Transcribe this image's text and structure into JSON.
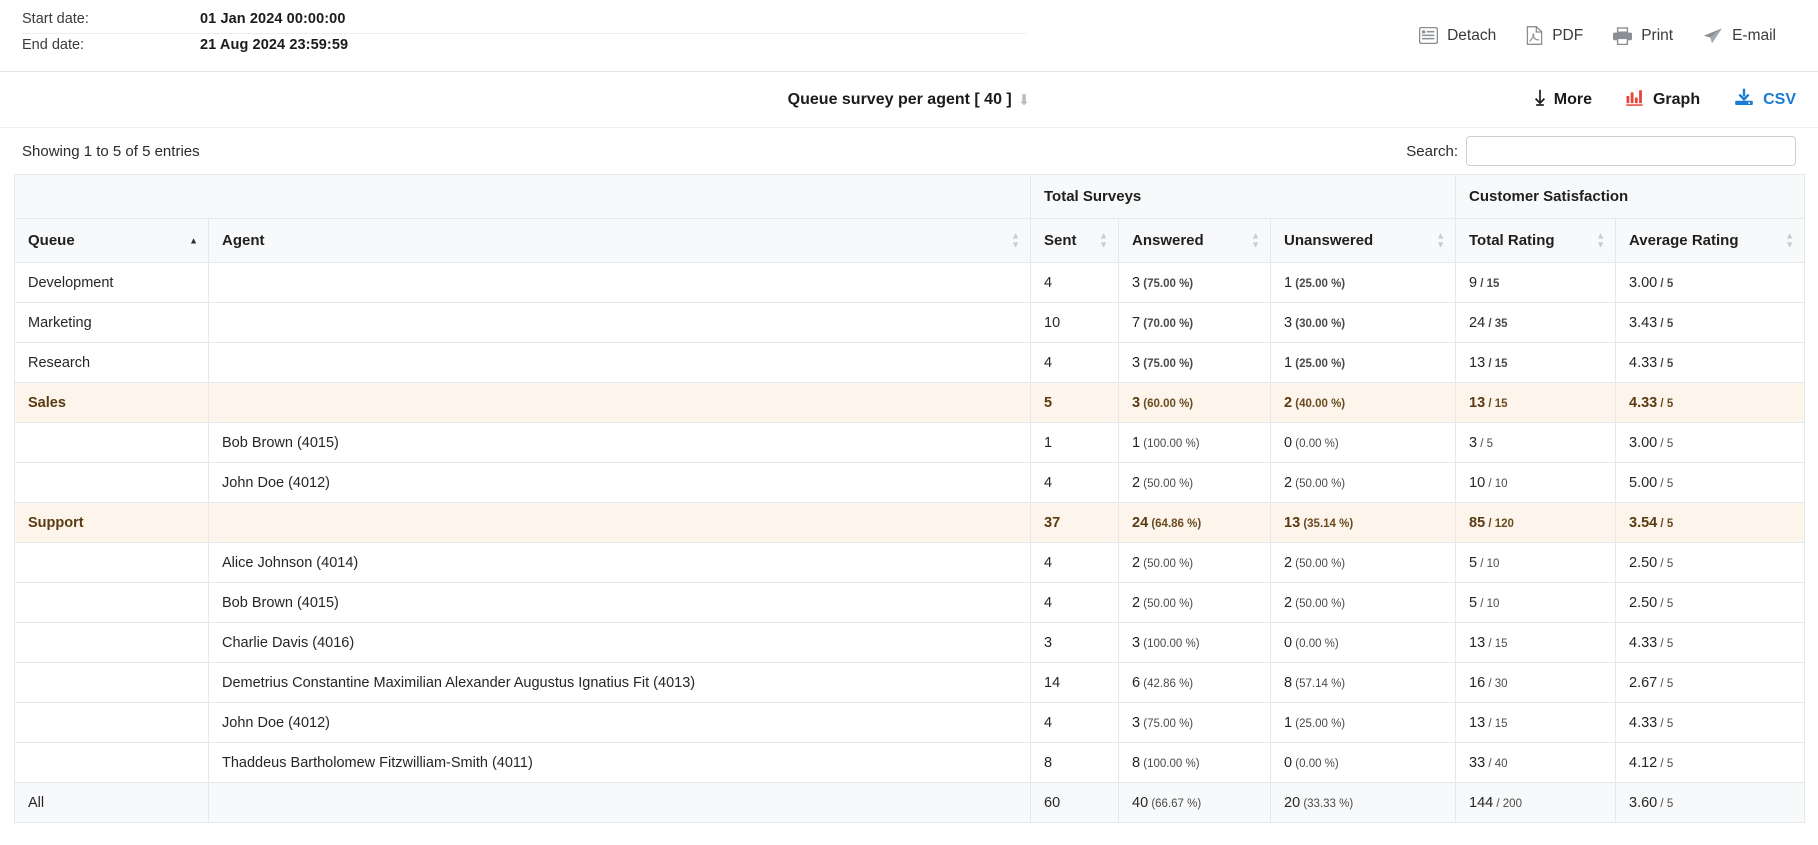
{
  "header": {
    "start_label": "Start date:",
    "start_value": "01 Jan 2024 00:00:00",
    "end_label": "End date:",
    "end_value": "21 Aug 2024 23:59:59",
    "actions": [
      {
        "name": "detach",
        "label": "Detach",
        "icon": "detach-icon"
      },
      {
        "name": "pdf",
        "label": "PDF",
        "icon": "pdf-icon"
      },
      {
        "name": "print",
        "label": "Print",
        "icon": "printer-icon"
      },
      {
        "name": "email",
        "label": "E-mail",
        "icon": "send-icon"
      }
    ]
  },
  "report": {
    "title": "Queue survey per agent [ 40 ]",
    "collapse_icon": "arrow-down-icon",
    "more_label": "More",
    "graph_label": "Graph",
    "csv_label": "CSV",
    "accent_csv": "#1a7bd4",
    "accent_graph": "#e8443a"
  },
  "info": {
    "showing": "Showing 1 to 5 of 5 entries",
    "search_label": "Search:",
    "search_value": "",
    "search_placeholder": ""
  },
  "table": {
    "group_headers": [
      {
        "label": "",
        "span": 2
      },
      {
        "label": "Total Surveys",
        "span": 3
      },
      {
        "label": "Customer Satisfaction",
        "span": 2
      }
    ],
    "columns": [
      {
        "label": "Queue",
        "sort": "asc"
      },
      {
        "label": "Agent",
        "sort": "none"
      },
      {
        "label": "Sent",
        "sort": "none"
      },
      {
        "label": "Answered",
        "sort": "none"
      },
      {
        "label": "Unanswered",
        "sort": "none"
      },
      {
        "label": "Total Rating",
        "sort": "none"
      },
      {
        "label": "Average Rating",
        "sort": "none"
      }
    ],
    "rows": [
      {
        "type": "queue",
        "highlight": false,
        "queue": "Development",
        "agent": "",
        "sent": "4",
        "answered": "3",
        "answered_pct": "(75.00 %)",
        "unanswered": "1",
        "unanswered_pct": "(25.00 %)",
        "total_rating": "9",
        "total_rating_max": "/ 15",
        "avg_rating": "3.00",
        "avg_rating_max": "/ 5"
      },
      {
        "type": "queue",
        "highlight": false,
        "queue": "Marketing",
        "agent": "",
        "sent": "10",
        "answered": "7",
        "answered_pct": "(70.00 %)",
        "unanswered": "3",
        "unanswered_pct": "(30.00 %)",
        "total_rating": "24",
        "total_rating_max": "/ 35",
        "avg_rating": "3.43",
        "avg_rating_max": "/ 5"
      },
      {
        "type": "queue",
        "highlight": false,
        "queue": "Research",
        "agent": "",
        "sent": "4",
        "answered": "3",
        "answered_pct": "(75.00 %)",
        "unanswered": "1",
        "unanswered_pct": "(25.00 %)",
        "total_rating": "13",
        "total_rating_max": "/ 15",
        "avg_rating": "4.33",
        "avg_rating_max": "/ 5"
      },
      {
        "type": "queue",
        "highlight": true,
        "queue": "Sales",
        "agent": "",
        "sent": "5",
        "answered": "3",
        "answered_pct": "(60.00 %)",
        "unanswered": "2",
        "unanswered_pct": "(40.00 %)",
        "total_rating": "13",
        "total_rating_max": "/ 15",
        "avg_rating": "4.33",
        "avg_rating_max": "/ 5"
      },
      {
        "type": "agent",
        "highlight": false,
        "queue": "",
        "agent": "Bob Brown (4015)",
        "sent": "1",
        "answered": "1",
        "answered_pct": "(100.00 %)",
        "unanswered": "0",
        "unanswered_pct": "(0.00 %)",
        "total_rating": "3",
        "total_rating_max": "/ 5",
        "avg_rating": "3.00",
        "avg_rating_max": "/ 5"
      },
      {
        "type": "agent",
        "highlight": false,
        "queue": "",
        "agent": "John Doe (4012)",
        "sent": "4",
        "answered": "2",
        "answered_pct": "(50.00 %)",
        "unanswered": "2",
        "unanswered_pct": "(50.00 %)",
        "total_rating": "10",
        "total_rating_max": "/ 10",
        "avg_rating": "5.00",
        "avg_rating_max": "/ 5"
      },
      {
        "type": "queue",
        "highlight": true,
        "queue": "Support",
        "agent": "",
        "sent": "37",
        "answered": "24",
        "answered_pct": "(64.86 %)",
        "unanswered": "13",
        "unanswered_pct": "(35.14 %)",
        "total_rating": "85",
        "total_rating_max": "/ 120",
        "avg_rating": "3.54",
        "avg_rating_max": "/ 5"
      },
      {
        "type": "agent",
        "highlight": false,
        "queue": "",
        "agent": "Alice Johnson (4014)",
        "sent": "4",
        "answered": "2",
        "answered_pct": "(50.00 %)",
        "unanswered": "2",
        "unanswered_pct": "(50.00 %)",
        "total_rating": "5",
        "total_rating_max": "/ 10",
        "avg_rating": "2.50",
        "avg_rating_max": "/ 5"
      },
      {
        "type": "agent",
        "highlight": false,
        "queue": "",
        "agent": "Bob Brown (4015)",
        "sent": "4",
        "answered": "2",
        "answered_pct": "(50.00 %)",
        "unanswered": "2",
        "unanswered_pct": "(50.00 %)",
        "total_rating": "5",
        "total_rating_max": "/ 10",
        "avg_rating": "2.50",
        "avg_rating_max": "/ 5"
      },
      {
        "type": "agent",
        "highlight": false,
        "queue": "",
        "agent": "Charlie Davis (4016)",
        "sent": "3",
        "answered": "3",
        "answered_pct": "(100.00 %)",
        "unanswered": "0",
        "unanswered_pct": "(0.00 %)",
        "total_rating": "13",
        "total_rating_max": "/ 15",
        "avg_rating": "4.33",
        "avg_rating_max": "/ 5"
      },
      {
        "type": "agent",
        "highlight": false,
        "queue": "",
        "agent": "Demetrius Constantine Maximilian Alexander Augustus Ignatius Fit (4013)",
        "sent": "14",
        "answered": "6",
        "answered_pct": "(42.86 %)",
        "unanswered": "8",
        "unanswered_pct": "(57.14 %)",
        "total_rating": "16",
        "total_rating_max": "/ 30",
        "avg_rating": "2.67",
        "avg_rating_max": "/ 5"
      },
      {
        "type": "agent",
        "highlight": false,
        "queue": "",
        "agent": "John Doe (4012)",
        "sent": "4",
        "answered": "3",
        "answered_pct": "(75.00 %)",
        "unanswered": "1",
        "unanswered_pct": "(25.00 %)",
        "total_rating": "13",
        "total_rating_max": "/ 15",
        "avg_rating": "4.33",
        "avg_rating_max": "/ 5"
      },
      {
        "type": "agent",
        "highlight": false,
        "queue": "",
        "agent": "Thaddeus Bartholomew Fitzwilliam-Smith (4011)",
        "sent": "8",
        "answered": "8",
        "answered_pct": "(100.00 %)",
        "unanswered": "0",
        "unanswered_pct": "(0.00 %)",
        "total_rating": "33",
        "total_rating_max": "/ 40",
        "avg_rating": "4.12",
        "avg_rating_max": "/ 5"
      },
      {
        "type": "total",
        "highlight": false,
        "queue": "All",
        "agent": "",
        "sent": "60",
        "answered": "40",
        "answered_pct": "(66.67 %)",
        "unanswered": "20",
        "unanswered_pct": "(33.33 %)",
        "total_rating": "144",
        "total_rating_max": "/ 200",
        "avg_rating": "3.60",
        "avg_rating_max": "/ 5"
      }
    ]
  }
}
